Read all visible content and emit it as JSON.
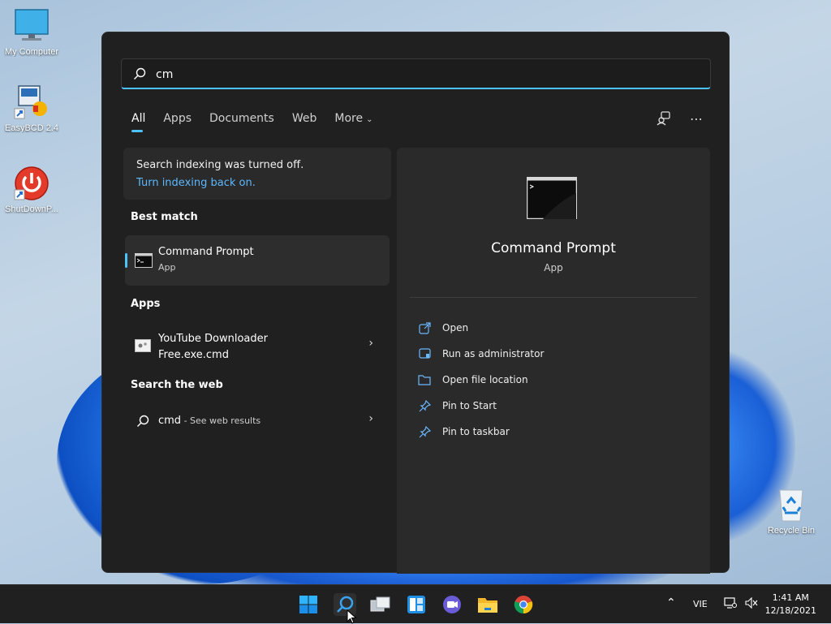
{
  "desktop": {
    "icons": [
      {
        "label": "My Computer"
      },
      {
        "label": "EasyBCD 2.4"
      },
      {
        "label": "ShutDownP..."
      },
      {
        "label": "Recycle Bin"
      }
    ]
  },
  "search": {
    "query": "cm",
    "tabs": [
      {
        "label": "All"
      },
      {
        "label": "Apps"
      },
      {
        "label": "Documents"
      },
      {
        "label": "Web"
      },
      {
        "label": "More"
      }
    ],
    "notice": {
      "line1": "Search indexing was turned off.",
      "link": "Turn indexing back on."
    },
    "best_match": {
      "heading": "Best match",
      "name": "Command Prompt",
      "type": "App"
    },
    "apps": {
      "heading": "Apps",
      "item_line1": "YouTube Downloader",
      "item_line2": "Free.exe.cmd"
    },
    "web": {
      "heading": "Search the web",
      "query": "cmd",
      "suffix": " - See web results"
    },
    "detail": {
      "name": "Command Prompt",
      "type": "App",
      "actions": [
        {
          "label": "Open",
          "icon": "open-icon"
        },
        {
          "label": "Run as administrator",
          "icon": "shield-icon"
        },
        {
          "label": "Open file location",
          "icon": "folder-icon"
        },
        {
          "label": "Pin to Start",
          "icon": "pin-icon"
        },
        {
          "label": "Pin to taskbar",
          "icon": "pin-icon"
        }
      ]
    }
  },
  "taskbar": {
    "language": "VIE",
    "time": "1:41 AM",
    "date": "12/18/2021"
  },
  "colors": {
    "accent": "#4cc2ff",
    "panel_bg": "#202020",
    "card_bg": "#2a2a2a"
  }
}
